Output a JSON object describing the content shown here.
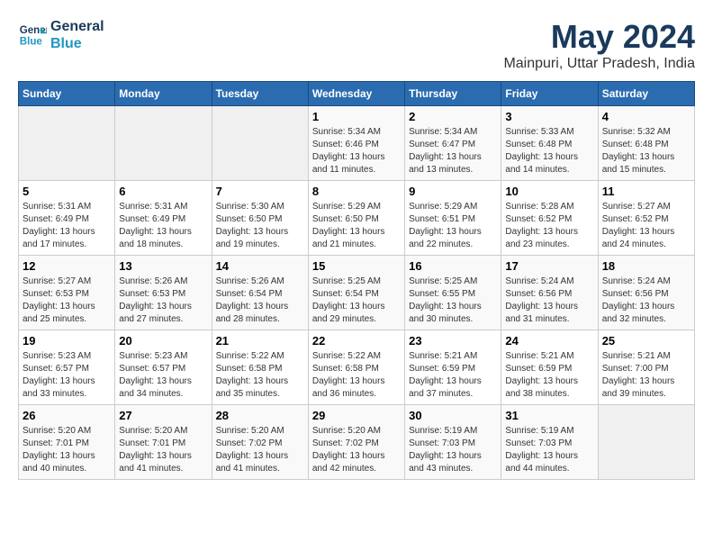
{
  "header": {
    "logo_line1": "General",
    "logo_line2": "Blue",
    "main_title": "May 2024",
    "subtitle": "Mainpuri, Uttar Pradesh, India"
  },
  "weekdays": [
    "Sunday",
    "Monday",
    "Tuesday",
    "Wednesday",
    "Thursday",
    "Friday",
    "Saturday"
  ],
  "weeks": [
    [
      {
        "day": "",
        "empty": true
      },
      {
        "day": "",
        "empty": true
      },
      {
        "day": "",
        "empty": true
      },
      {
        "day": "1",
        "sunrise": "5:34 AM",
        "sunset": "6:46 PM",
        "daylight": "13 hours and 11 minutes."
      },
      {
        "day": "2",
        "sunrise": "5:34 AM",
        "sunset": "6:47 PM",
        "daylight": "13 hours and 13 minutes."
      },
      {
        "day": "3",
        "sunrise": "5:33 AM",
        "sunset": "6:48 PM",
        "daylight": "13 hours and 14 minutes."
      },
      {
        "day": "4",
        "sunrise": "5:32 AM",
        "sunset": "6:48 PM",
        "daylight": "13 hours and 15 minutes."
      }
    ],
    [
      {
        "day": "5",
        "sunrise": "5:31 AM",
        "sunset": "6:49 PM",
        "daylight": "13 hours and 17 minutes."
      },
      {
        "day": "6",
        "sunrise": "5:31 AM",
        "sunset": "6:49 PM",
        "daylight": "13 hours and 18 minutes."
      },
      {
        "day": "7",
        "sunrise": "5:30 AM",
        "sunset": "6:50 PM",
        "daylight": "13 hours and 19 minutes."
      },
      {
        "day": "8",
        "sunrise": "5:29 AM",
        "sunset": "6:50 PM",
        "daylight": "13 hours and 21 minutes."
      },
      {
        "day": "9",
        "sunrise": "5:29 AM",
        "sunset": "6:51 PM",
        "daylight": "13 hours and 22 minutes."
      },
      {
        "day": "10",
        "sunrise": "5:28 AM",
        "sunset": "6:52 PM",
        "daylight": "13 hours and 23 minutes."
      },
      {
        "day": "11",
        "sunrise": "5:27 AM",
        "sunset": "6:52 PM",
        "daylight": "13 hours and 24 minutes."
      }
    ],
    [
      {
        "day": "12",
        "sunrise": "5:27 AM",
        "sunset": "6:53 PM",
        "daylight": "13 hours and 25 minutes."
      },
      {
        "day": "13",
        "sunrise": "5:26 AM",
        "sunset": "6:53 PM",
        "daylight": "13 hours and 27 minutes."
      },
      {
        "day": "14",
        "sunrise": "5:26 AM",
        "sunset": "6:54 PM",
        "daylight": "13 hours and 28 minutes."
      },
      {
        "day": "15",
        "sunrise": "5:25 AM",
        "sunset": "6:54 PM",
        "daylight": "13 hours and 29 minutes."
      },
      {
        "day": "16",
        "sunrise": "5:25 AM",
        "sunset": "6:55 PM",
        "daylight": "13 hours and 30 minutes."
      },
      {
        "day": "17",
        "sunrise": "5:24 AM",
        "sunset": "6:56 PM",
        "daylight": "13 hours and 31 minutes."
      },
      {
        "day": "18",
        "sunrise": "5:24 AM",
        "sunset": "6:56 PM",
        "daylight": "13 hours and 32 minutes."
      }
    ],
    [
      {
        "day": "19",
        "sunrise": "5:23 AM",
        "sunset": "6:57 PM",
        "daylight": "13 hours and 33 minutes."
      },
      {
        "day": "20",
        "sunrise": "5:23 AM",
        "sunset": "6:57 PM",
        "daylight": "13 hours and 34 minutes."
      },
      {
        "day": "21",
        "sunrise": "5:22 AM",
        "sunset": "6:58 PM",
        "daylight": "13 hours and 35 minutes."
      },
      {
        "day": "22",
        "sunrise": "5:22 AM",
        "sunset": "6:58 PM",
        "daylight": "13 hours and 36 minutes."
      },
      {
        "day": "23",
        "sunrise": "5:21 AM",
        "sunset": "6:59 PM",
        "daylight": "13 hours and 37 minutes."
      },
      {
        "day": "24",
        "sunrise": "5:21 AM",
        "sunset": "6:59 PM",
        "daylight": "13 hours and 38 minutes."
      },
      {
        "day": "25",
        "sunrise": "5:21 AM",
        "sunset": "7:00 PM",
        "daylight": "13 hours and 39 minutes."
      }
    ],
    [
      {
        "day": "26",
        "sunrise": "5:20 AM",
        "sunset": "7:01 PM",
        "daylight": "13 hours and 40 minutes."
      },
      {
        "day": "27",
        "sunrise": "5:20 AM",
        "sunset": "7:01 PM",
        "daylight": "13 hours and 41 minutes."
      },
      {
        "day": "28",
        "sunrise": "5:20 AM",
        "sunset": "7:02 PM",
        "daylight": "13 hours and 41 minutes."
      },
      {
        "day": "29",
        "sunrise": "5:20 AM",
        "sunset": "7:02 PM",
        "daylight": "13 hours and 42 minutes."
      },
      {
        "day": "30",
        "sunrise": "5:19 AM",
        "sunset": "7:03 PM",
        "daylight": "13 hours and 43 minutes."
      },
      {
        "day": "31",
        "sunrise": "5:19 AM",
        "sunset": "7:03 PM",
        "daylight": "13 hours and 44 minutes."
      },
      {
        "day": "",
        "empty": true
      }
    ]
  ],
  "labels": {
    "sunrise": "Sunrise: ",
    "sunset": "Sunset: ",
    "daylight": "Daylight: "
  }
}
